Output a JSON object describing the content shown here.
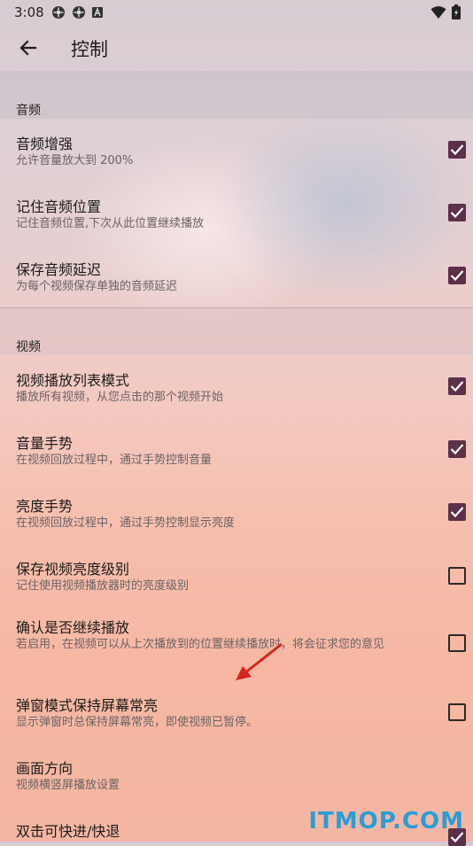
{
  "status": {
    "time": "3:08"
  },
  "appbar": {
    "title": "控制"
  },
  "sections": {
    "audio": {
      "header": "音频",
      "items": [
        {
          "title": "音频增强",
          "subtitle": "允许音量放大到 200%",
          "checked": true
        },
        {
          "title": "记住音频位置",
          "subtitle": "记住音频位置,下次从此位置继续播放",
          "checked": true
        },
        {
          "title": "保存音频延迟",
          "subtitle": "为每个视频保存单独的音频延迟",
          "checked": true
        }
      ]
    },
    "video": {
      "header": "视频",
      "items": [
        {
          "title": "视频播放列表模式",
          "subtitle": "播放所有视频，从您点击的那个视频开始",
          "checked": true
        },
        {
          "title": "音量手势",
          "subtitle": "在视频回放过程中，通过手势控制音量",
          "checked": true
        },
        {
          "title": "亮度手势",
          "subtitle": "在视频回放过程中，通过手势控制显示亮度",
          "checked": true
        },
        {
          "title": "保存视频亮度级别",
          "subtitle": "记住使用视频播放器时的亮度级别",
          "checked": false
        },
        {
          "title": "确认是否继续播放",
          "subtitle": "若启用，在视频可以从上次播放到的位置继续播放时，将会征求您的意见",
          "checked": false
        },
        {
          "title": "弹窗模式保持屏幕常亮",
          "subtitle": "显示弹窗时总保持屏幕常亮，即使视频已暂停。",
          "checked": false
        },
        {
          "title": "画面方向",
          "subtitle": "视频横竖屏播放设置"
        },
        {
          "title": "双击可快进/快退",
          "checked": true
        }
      ]
    }
  },
  "watermark": "ITMOP.COM",
  "colors": {
    "checkbox_on": "#5b3048",
    "watermark": "#2a9dd8"
  }
}
